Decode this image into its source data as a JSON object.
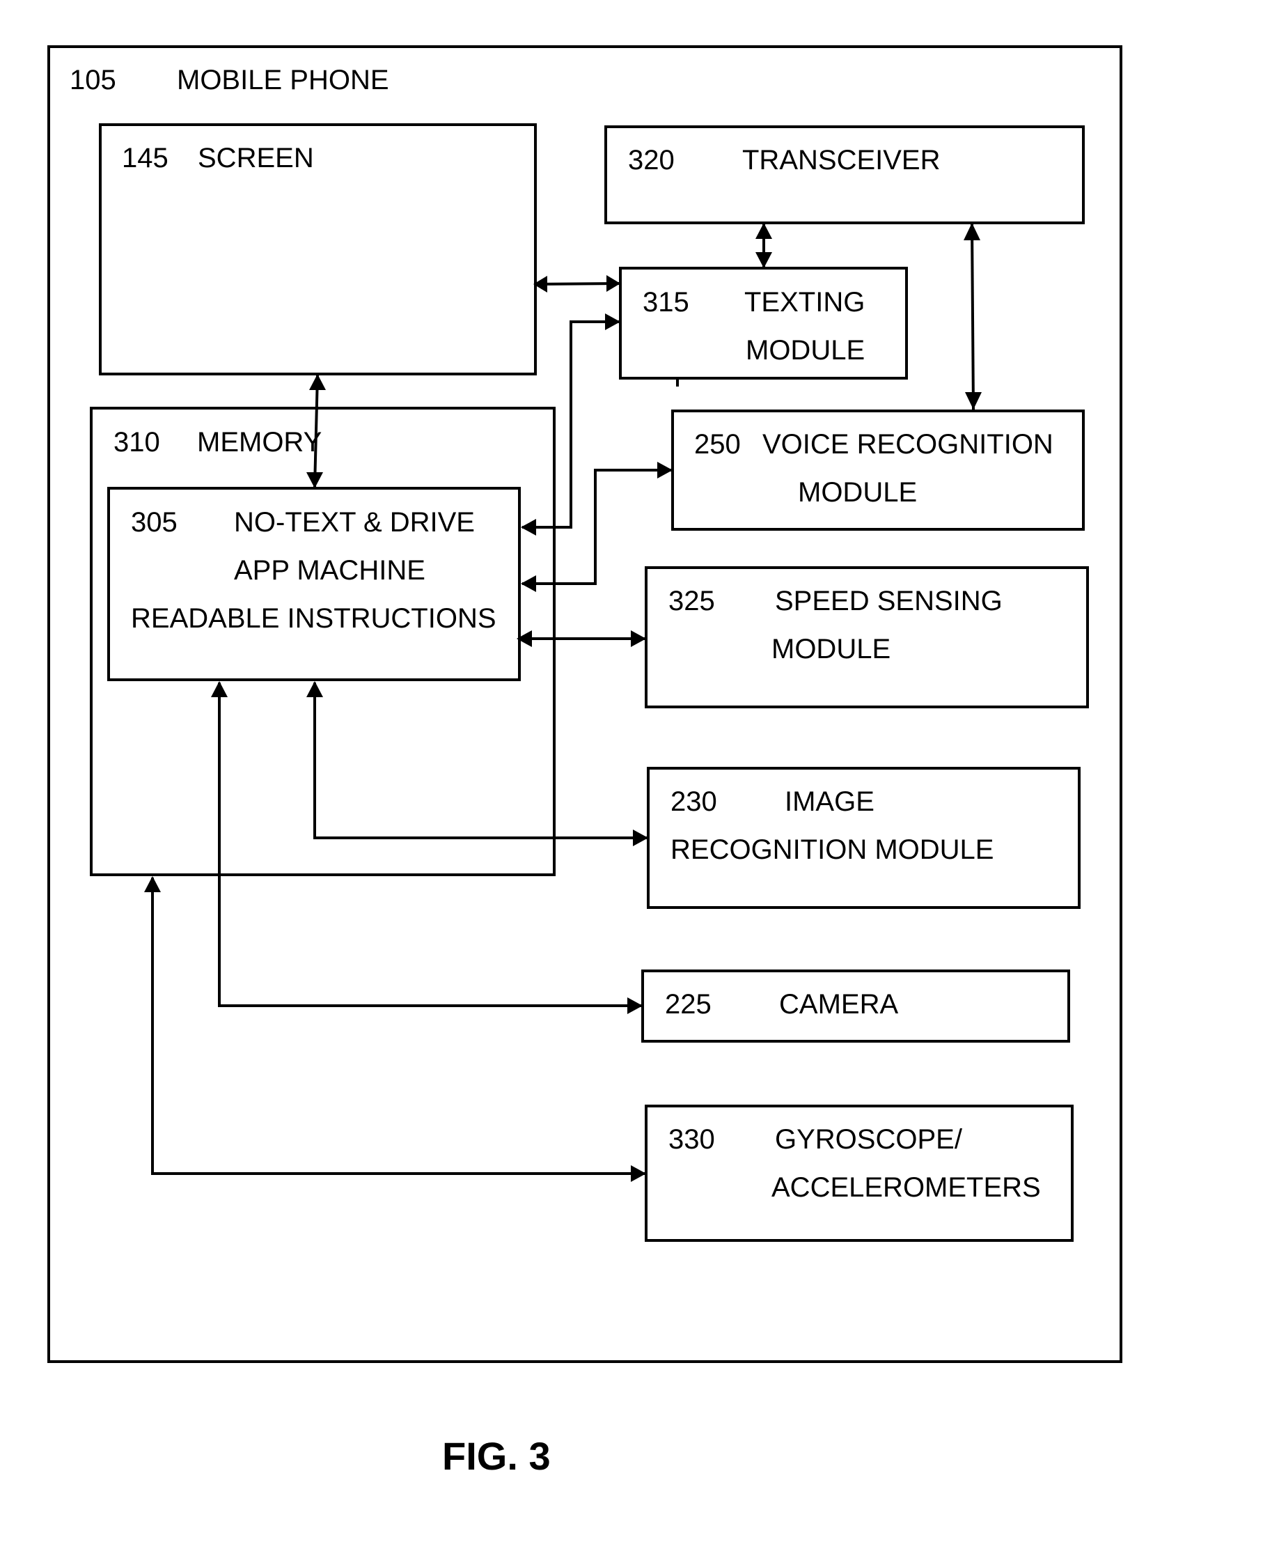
{
  "figure_label": "FIG. 3",
  "outer": {
    "ref": "105",
    "name": "MOBILE PHONE"
  },
  "screen": {
    "ref": "145",
    "name": "SCREEN"
  },
  "memory": {
    "ref": "310",
    "name": "MEMORY"
  },
  "app": {
    "ref": "305",
    "line1": "NO-TEXT & DRIVE",
    "line2": "APP MACHINE",
    "line3": "READABLE INSTRUCTIONS"
  },
  "transceiver": {
    "ref": "320",
    "name": "TRANSCEIVER"
  },
  "texting": {
    "ref": "315",
    "line1": "TEXTING",
    "line2": "MODULE"
  },
  "voice": {
    "ref": "250",
    "line1": "VOICE RECOGNITION",
    "line2": "MODULE"
  },
  "speed": {
    "ref": "325",
    "line1": "SPEED SENSING",
    "line2": "MODULE"
  },
  "image": {
    "ref": "230",
    "line1": "IMAGE",
    "line2": "RECOGNITION  MODULE"
  },
  "camera": {
    "ref": "225",
    "name": "CAMERA"
  },
  "gyro": {
    "ref": "330",
    "line1": "GYROSCOPE/",
    "line2": "ACCELEROMETERS"
  }
}
